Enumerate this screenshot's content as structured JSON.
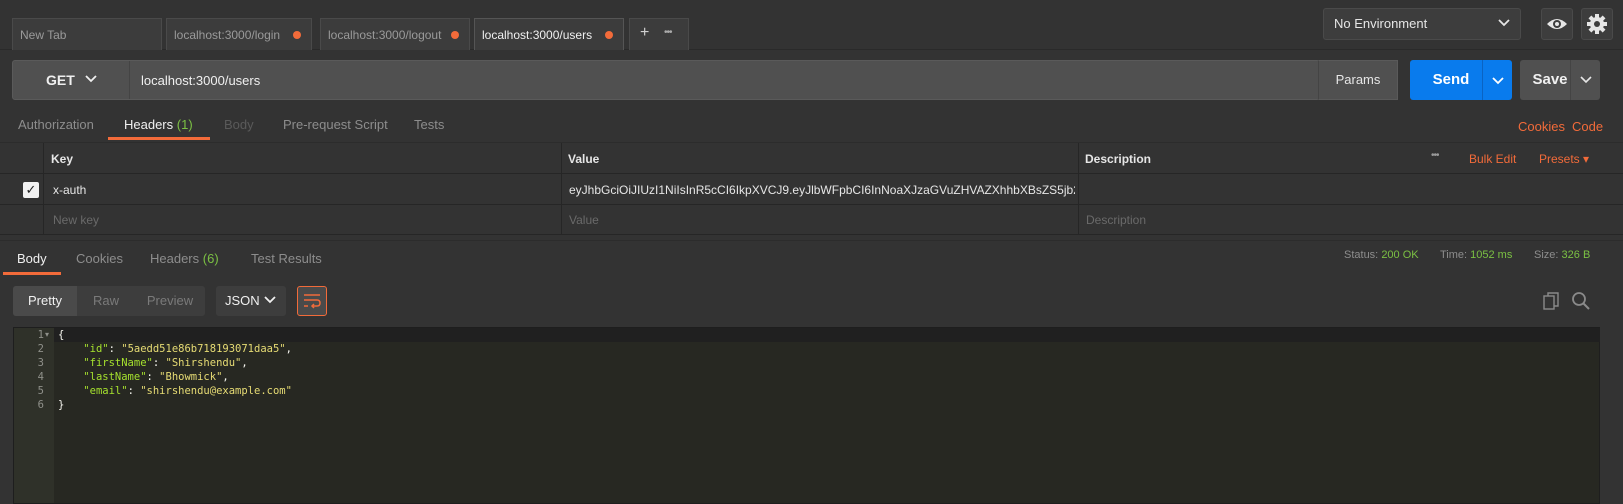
{
  "tabs": [
    {
      "label": "New Tab",
      "dirty": false
    },
    {
      "label": "localhost:3000/login",
      "dirty": true
    },
    {
      "label": "localhost:3000/logout",
      "dirty": true
    },
    {
      "label": "localhost:3000/users",
      "dirty": true,
      "active": true
    }
  ],
  "tab_controls": {
    "add_label": "+",
    "more_label": "•••"
  },
  "environment": {
    "selected": "No Environment"
  },
  "request": {
    "method": "GET",
    "url": "localhost:3000/users",
    "params_label": "Params",
    "send_label": "Send",
    "save_label": "Save"
  },
  "request_tabs": {
    "authorization": "Authorization",
    "headers": "Headers",
    "headers_count": "(1)",
    "body": "Body",
    "prerequest": "Pre-request Script",
    "tests": "Tests",
    "cookies_link": "Cookies",
    "code_link": "Code"
  },
  "headers_table": {
    "col_key": "Key",
    "col_value": "Value",
    "col_description": "Description",
    "more": "•••",
    "bulk_edit": "Bulk Edit",
    "presets": "Presets ▾",
    "rows": [
      {
        "checked": true,
        "key": "x-auth",
        "value": "eyJhbGciOiJIUzI1NiIsInR5cCI6IkpXVCJ9.eyJlbWFpbCI6InNoaXJzaGVuZHVAZXhhbXBsZS5jb2...",
        "description": ""
      }
    ],
    "placeholders": {
      "key": "New key",
      "value": "Value",
      "description": "Description"
    }
  },
  "response_tabs": {
    "body": "Body",
    "cookies": "Cookies",
    "headers": "Headers",
    "headers_count": "(6)",
    "test_results": "Test Results"
  },
  "status": {
    "status_label": "Status:",
    "status_value": "200 OK",
    "time_label": "Time:",
    "time_value": "1052 ms",
    "size_label": "Size:",
    "size_value": "326 B"
  },
  "view_modes": {
    "pretty": "Pretty",
    "raw": "Raw",
    "preview": "Preview",
    "format": "JSON"
  },
  "response_body": {
    "line_numbers": [
      "1",
      "2",
      "3",
      "4",
      "5",
      "6"
    ],
    "id_key": "\"id\"",
    "id_value": "\"5aedd51e86b718193071daa5\"",
    "firstName_key": "\"firstName\"",
    "firstName_value": "\"Shirshendu\"",
    "lastName_key": "\"lastName\"",
    "lastName_value": "\"Bhowmick\"",
    "email_key": "\"email\"",
    "email_value": "\"shirshendu@example.com\""
  },
  "colors": {
    "accent_orange": "#f26b3a",
    "send_blue": "#097bed",
    "success_green": "#7bc043",
    "background": "#333333"
  }
}
